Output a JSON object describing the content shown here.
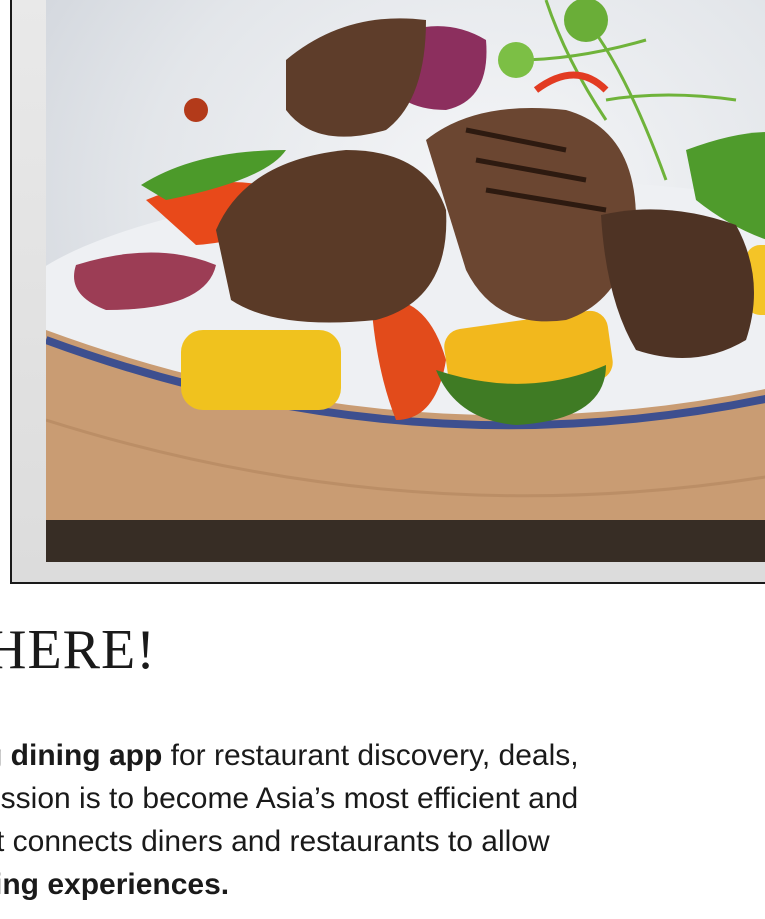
{
  "hero": {
    "image_icon": "food-photo-icon"
  },
  "heading": {
    "text": "HERE!"
  },
  "paragraph": {
    "line1_bold": "g dining app",
    "line1_rest": " for restaurant discovery, deals,",
    "line2": "ission is to become Asia’s most efficient and",
    "line3": "t connects diners and restaurants to allow",
    "line4_bold": "ing experiences."
  }
}
